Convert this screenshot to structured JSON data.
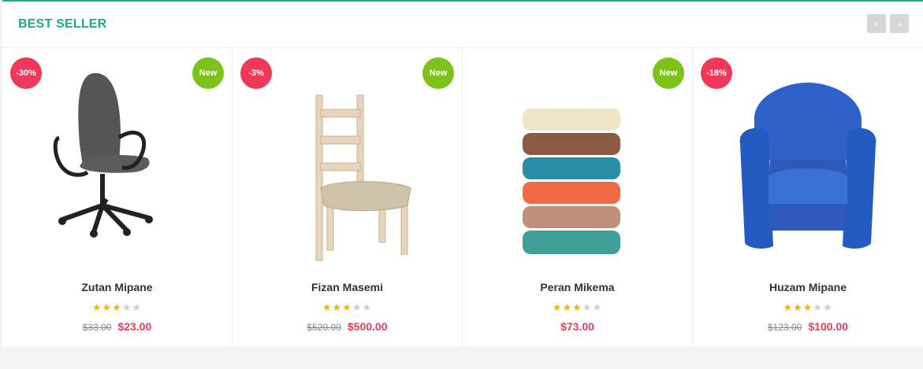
{
  "section": {
    "title": "BEST SELLER",
    "prev_icon": "‹",
    "next_icon": "›"
  },
  "products": [
    {
      "name": "Zutan Mipane",
      "rating": 3,
      "old_price": "$33.00",
      "price": "$23.00",
      "discount": "-30%",
      "new_label": "New"
    },
    {
      "name": "Fizan Masemi",
      "rating": 3,
      "old_price": "$520.00",
      "price": "$500.00",
      "discount": "-3%",
      "new_label": "New"
    },
    {
      "name": "Peran Mikema",
      "rating": 3,
      "old_price": "",
      "price": "$73.00",
      "discount": "",
      "new_label": "New"
    },
    {
      "name": "Huzam Mipane",
      "rating": 3,
      "old_price": "$123.00",
      "price": "$100.00",
      "discount": "-18%",
      "new_label": ""
    }
  ],
  "colors": {
    "accent": "#20a88e",
    "sale": "#f0395a",
    "new": "#7dc21b",
    "star": "#f0b700"
  }
}
